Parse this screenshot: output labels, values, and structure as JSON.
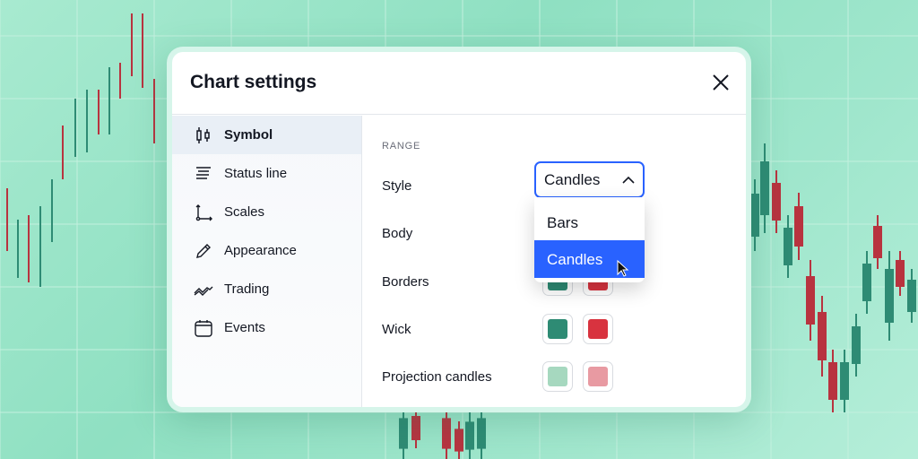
{
  "dialog": {
    "title": "Chart settings",
    "close_icon": "close-icon"
  },
  "sidebar": {
    "items": [
      {
        "label": "Symbol",
        "icon": "candles-icon",
        "active": true
      },
      {
        "label": "Status line",
        "icon": "status-line-icon"
      },
      {
        "label": "Scales",
        "icon": "scales-icon"
      },
      {
        "label": "Appearance",
        "icon": "pencil-icon"
      },
      {
        "label": "Trading",
        "icon": "trading-icon"
      },
      {
        "label": "Events",
        "icon": "calendar-icon"
      }
    ]
  },
  "content": {
    "section": "RANGE",
    "rows": {
      "style": "Style",
      "body": "Body",
      "borders": "Borders",
      "wick": "Wick",
      "projection": "Projection candles"
    },
    "style_select": {
      "value": "Candles",
      "options": [
        "Bars",
        "Candles"
      ],
      "highlighted": "Candles"
    },
    "colors": {
      "up": "#2e8b74",
      "down": "#d8333f",
      "proj_up": "#a6d8bf",
      "proj_down": "#e89aa2"
    }
  }
}
